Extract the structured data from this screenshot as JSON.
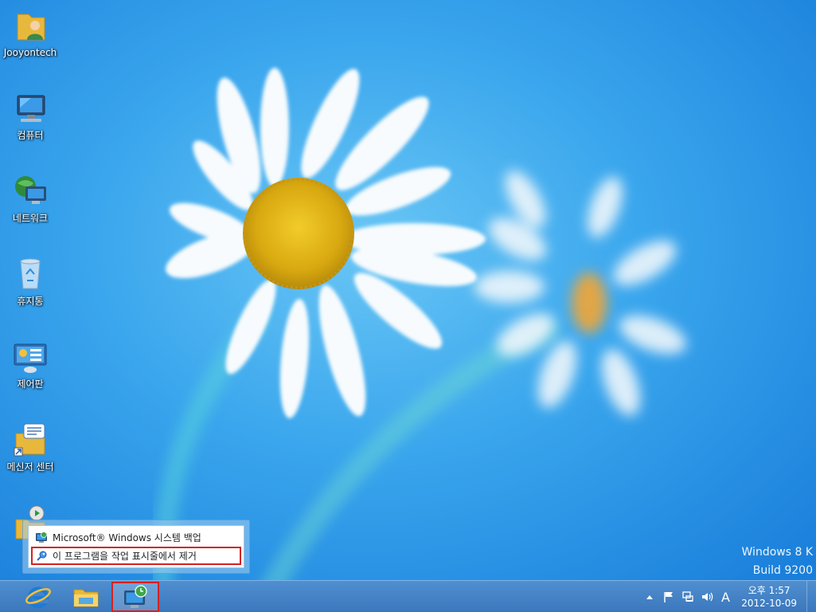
{
  "desktop": {
    "icons": [
      {
        "label": "Jooyontech",
        "icon": "user-folder-icon"
      },
      {
        "label": "컴퓨터",
        "icon": "computer-icon"
      },
      {
        "label": "네트워크",
        "icon": "network-icon"
      },
      {
        "label": "휴지통",
        "icon": "recycle-bin-icon"
      },
      {
        "label": "제어판",
        "icon": "control-panel-icon"
      },
      {
        "label": "메신저 센터",
        "icon": "messenger-folder-icon"
      }
    ]
  },
  "watermark": {
    "line1": "Windows 8 K",
    "line2": "Build 9200"
  },
  "jumplist": {
    "items": [
      {
        "label": "Microsoft® Windows 시스템 백업",
        "icon": "backup-app-icon"
      },
      {
        "label": "이 프로그램을 작업 표시줄에서 제거",
        "icon": "unpin-icon"
      }
    ]
  },
  "taskbar": {
    "buttons": [
      {
        "name": "Internet Explorer",
        "icon": "ie-icon"
      },
      {
        "name": "File Explorer",
        "icon": "file-explorer-icon"
      },
      {
        "name": "Windows Backup",
        "icon": "backup-app-icon"
      }
    ],
    "ime_label": "A",
    "clock": {
      "time": "오후 1:57",
      "date": "2012-10-09"
    }
  },
  "colors": {
    "highlight_border": "#d32222",
    "taskbar": "#3b77bd",
    "desktop": "#36a3ec"
  }
}
